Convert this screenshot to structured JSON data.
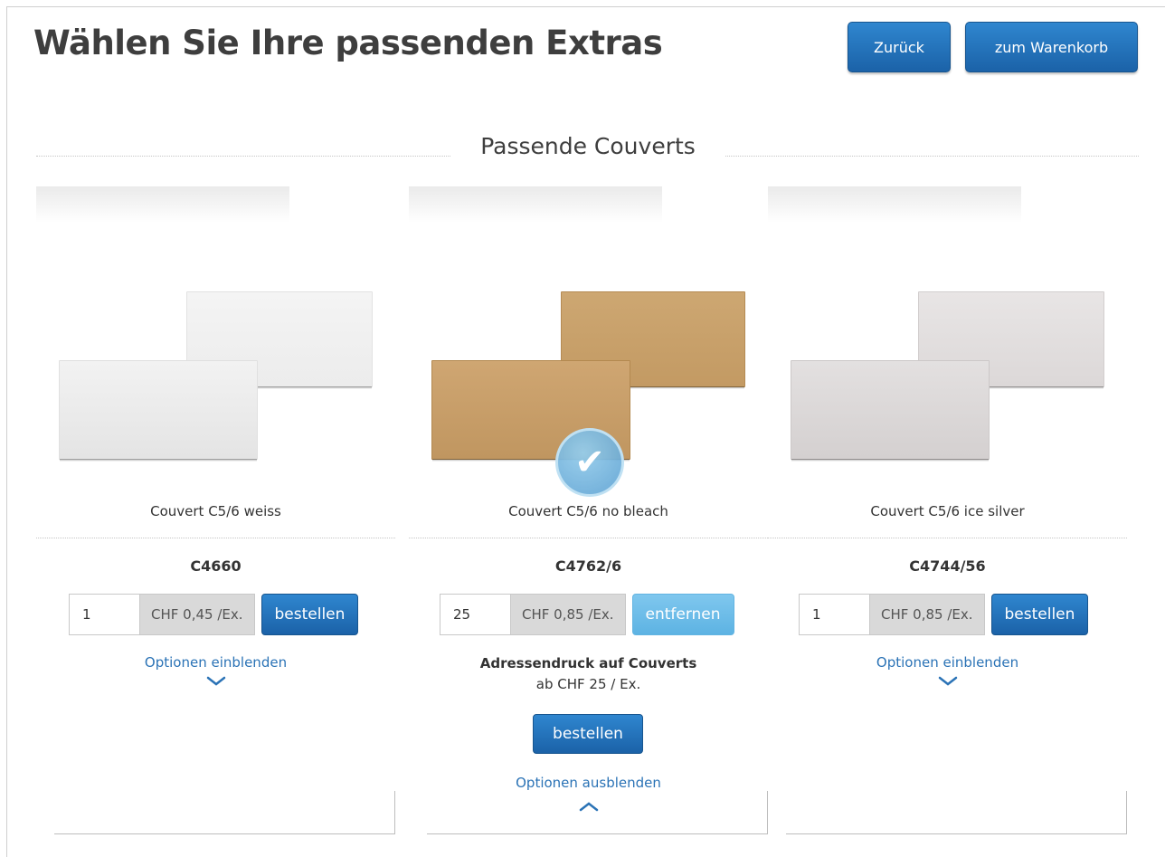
{
  "header": {
    "title": "Wählen Sie Ihre passenden Extras",
    "back_label": "Zurück",
    "cart_label": "zum Warenkorb"
  },
  "section": {
    "title": "Passende Couverts"
  },
  "products": [
    {
      "name": "Couvert C5/6 weiss",
      "sku": "C4660",
      "quantity": "1",
      "price": "CHF 0,45 /Ex.",
      "action_label": "bestellen",
      "options_label": "Optionen einblenden",
      "options_icon": "chevron-down-icon",
      "selected": false,
      "colors": {
        "envelope": "#efefef"
      }
    },
    {
      "name": "Couvert C5/6 no bleach",
      "sku": "C4762/6",
      "quantity": "25",
      "price": "CHF 0,85 /Ex.",
      "action_label": "entfernen",
      "options_label": "Optionen ausblenden",
      "options_icon": "chevron-up-icon",
      "selected": true,
      "addon": {
        "title": "Adressendruck auf Couverts",
        "price": "ab CHF 25 / Ex.",
        "action_label": "bestellen"
      },
      "colors": {
        "envelope": "#c9a06a"
      }
    },
    {
      "name": "Couvert C5/6 ice silver",
      "sku": "C4744/56",
      "quantity": "1",
      "price": "CHF 0,85 /Ex.",
      "action_label": "bestellen",
      "options_label": "Optionen einblenden",
      "options_icon": "chevron-down-icon",
      "selected": false,
      "colors": {
        "envelope": "#ddd9d9"
      }
    }
  ],
  "colors": {
    "primary_button": "#1f6cb5",
    "remove_button": "#6cbce8",
    "link": "#2b73b6"
  }
}
